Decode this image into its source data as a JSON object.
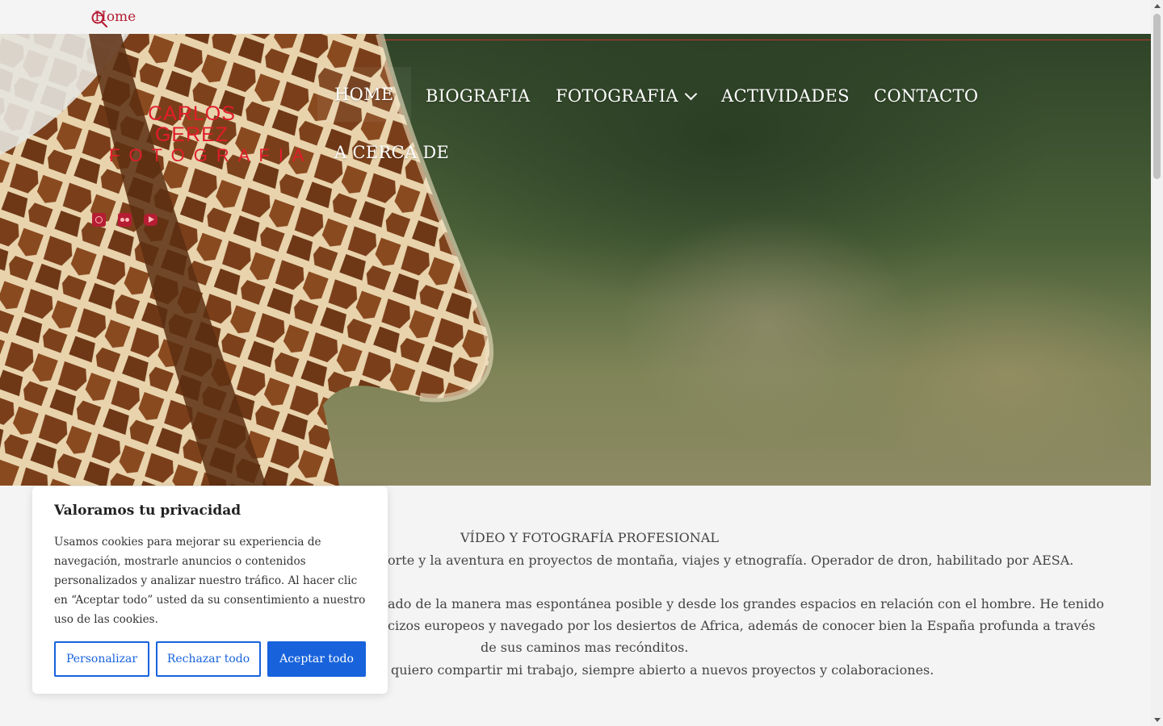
{
  "topbar": {
    "home_label": "Home"
  },
  "logo": {
    "line1": "CARLOS GEREZ",
    "line2": "FOTOGRAFIA"
  },
  "nav": {
    "items": [
      {
        "label": "HOME"
      },
      {
        "label": "BIOGRAFIA"
      },
      {
        "label": "FOTOGRAFIA"
      },
      {
        "label": "ACTIVIDADES"
      },
      {
        "label": "CONTACTO"
      },
      {
        "label": "A CERCA DE"
      }
    ]
  },
  "social": [
    "instagram-icon",
    "flickr-icon",
    "youtube-icon"
  ],
  "content": {
    "line1": "VÍDEO Y FOTOGRAFÍA PROFESIONAL",
    "line2": "orte y la aventura en proyectos de montaña, viajes y etnografía. Operador de dron, habilitado por AESA.",
    "line3": "ado de la manera mas espontánea posible y desde los grandes espacios en relación con el hombre. He tenido",
    "line4": "cizos europeos y navegado por los desiertos de Africa, además de conocer bien la España profunda a través",
    "line5": "de sus caminos mas recónditos.",
    "line6": "quiero compartir mi trabajo, siempre abierto a nuevos proyectos y colaboraciones."
  },
  "cookie": {
    "title": "Valoramos tu privacidad",
    "text": "Usamos cookies para mejorar su experiencia de navegación, mostrarle anuncios o contenidos personalizados y analizar nuestro tráfico. Al hacer clic en “Aceptar todo” usted da su consentimiento a nuestro uso de las cookies.",
    "customize": "Personalizar",
    "reject": "Rechazar todo",
    "accept": "Aceptar todo"
  },
  "colors": {
    "accent": "#b61d33",
    "logo": "#e21d2b",
    "button": "#1863dc"
  }
}
